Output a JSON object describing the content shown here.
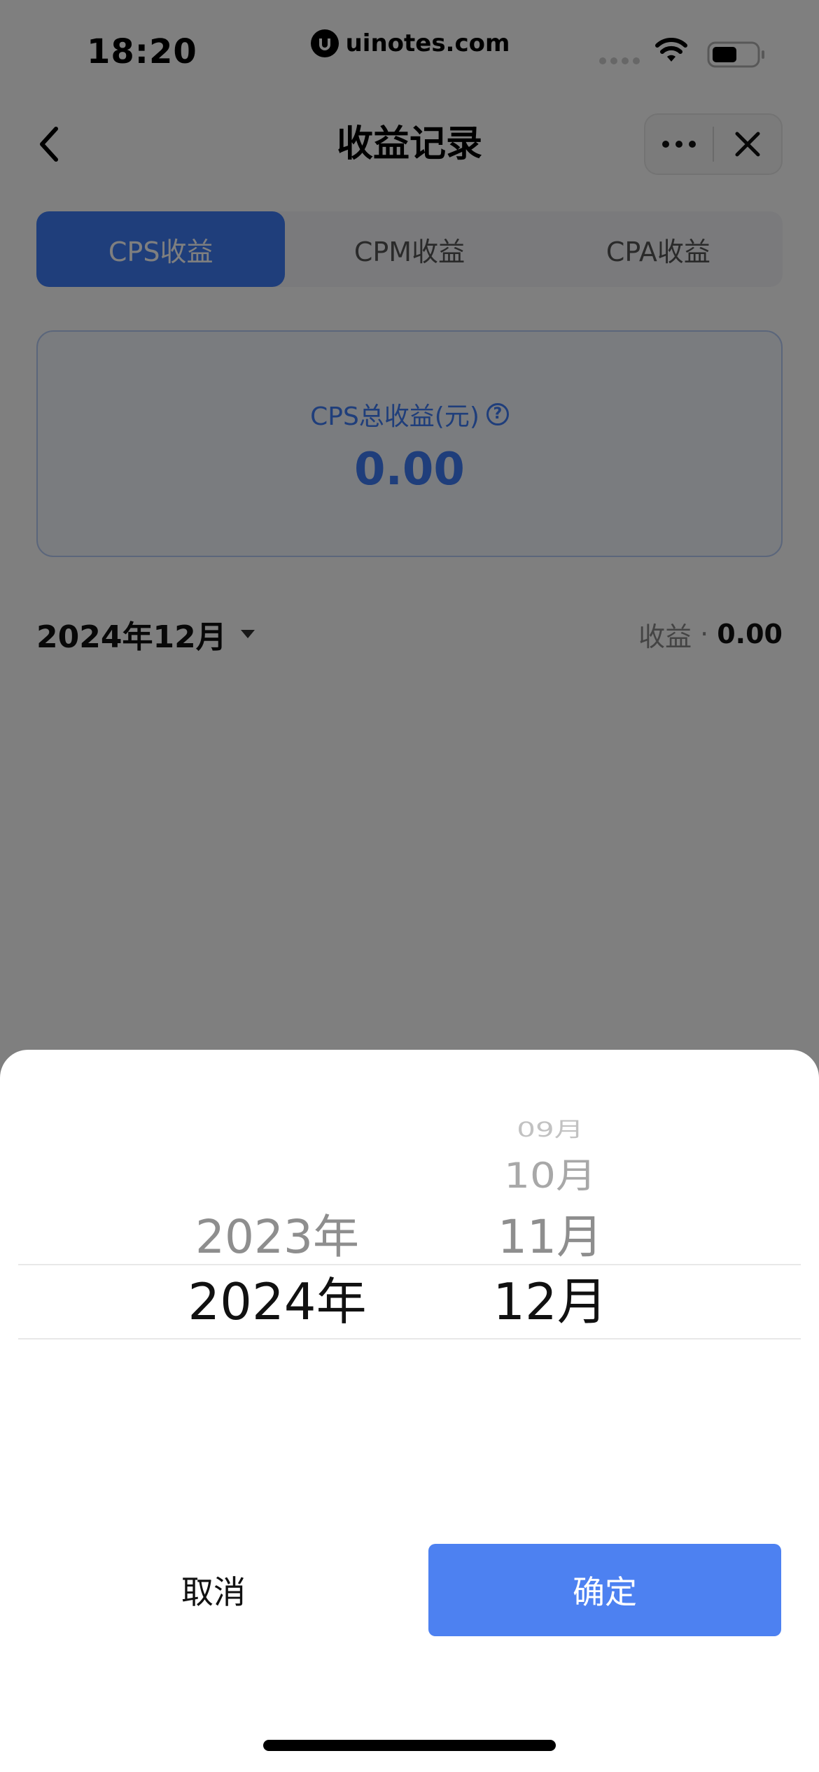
{
  "status_bar": {
    "time": "18:20",
    "watermark": "uinotes.com",
    "icons": [
      "signal-icon",
      "wifi-icon",
      "battery-icon"
    ]
  },
  "nav": {
    "title": "收益记录",
    "back_icon": "chevron-left-icon",
    "more_icon": "more-dots-icon",
    "close_icon": "close-icon"
  },
  "tabs": [
    {
      "label": "CPS收益",
      "active": true
    },
    {
      "label": "CPM收益",
      "active": false
    },
    {
      "label": "CPA收益",
      "active": false
    }
  ],
  "summary": {
    "label": "CPS总收益(元)",
    "help_icon": "question-circle-icon",
    "value": "0.00"
  },
  "month_row": {
    "selected_month": "2024年12月",
    "income_label": "收益",
    "separator": "·",
    "income_value": "0.00"
  },
  "picker": {
    "years": {
      "prev": "2023年",
      "selected": "2024年"
    },
    "months": {
      "far": "09月",
      "above": "10月",
      "prev": "11月",
      "selected": "12月"
    }
  },
  "buttons": {
    "cancel": "取消",
    "confirm": "确定"
  },
  "colors": {
    "accent": "#3f7df6",
    "confirm_button": "#4d81f1",
    "mask": "rgba(0,0,0,0.5)"
  }
}
